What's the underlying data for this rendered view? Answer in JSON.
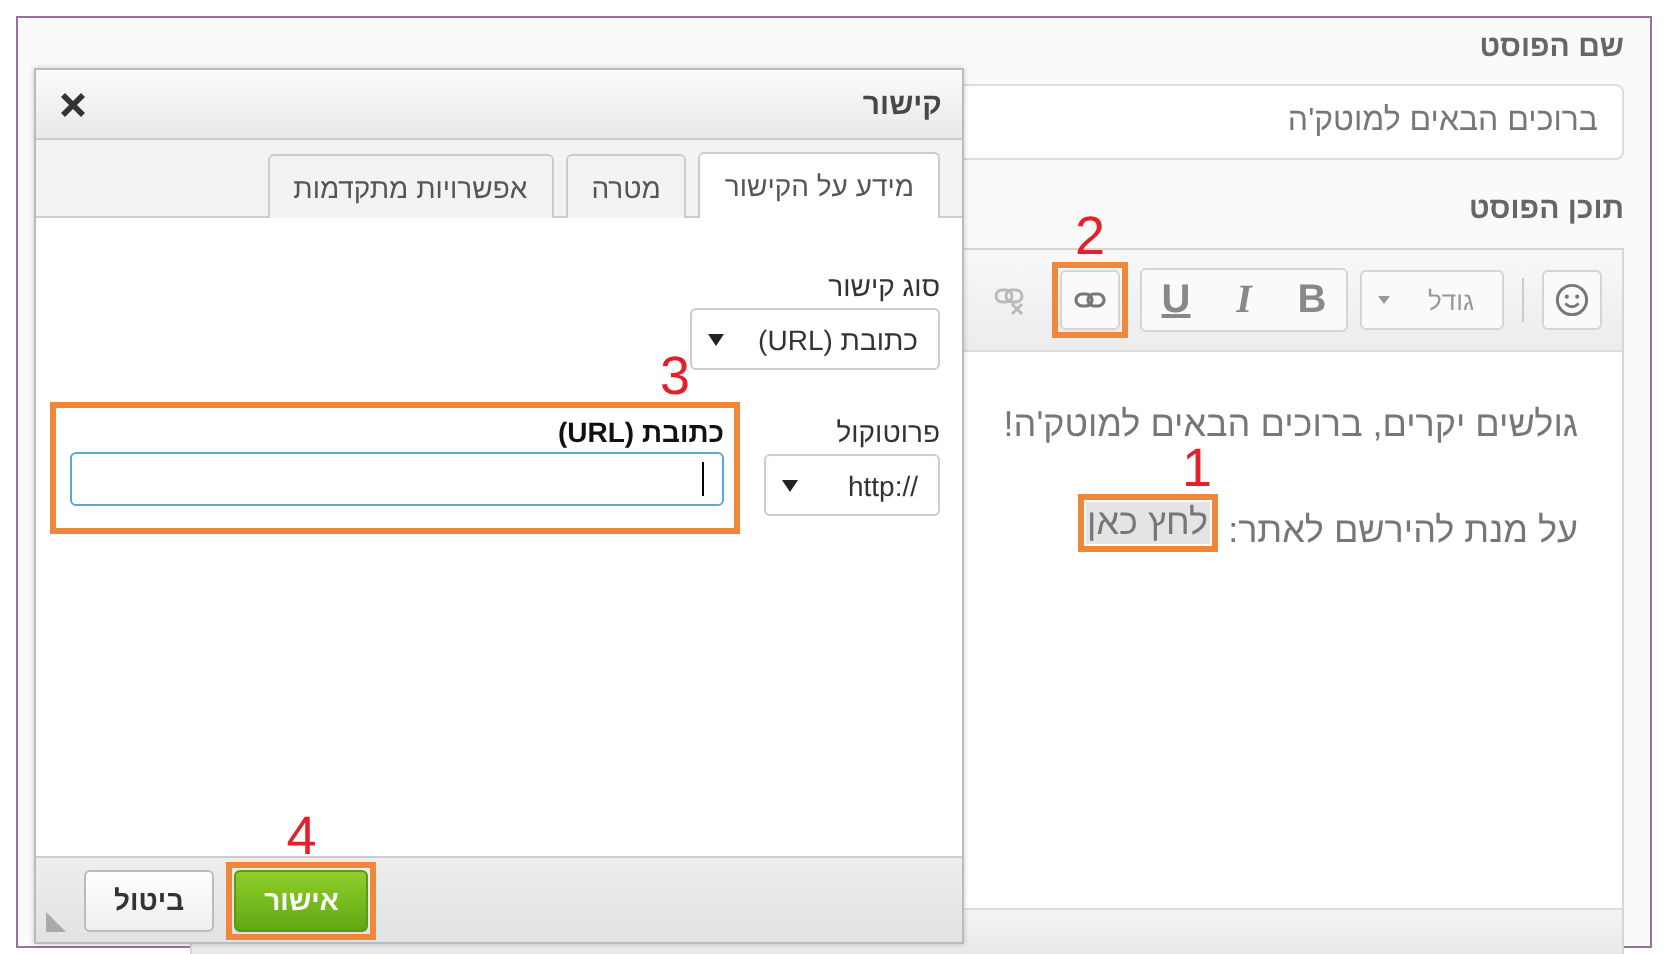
{
  "post_form": {
    "title_label": "שם הפוסט",
    "title_value": "ברוכים הבאים למוטק'ה",
    "content_label": "תוכן הפוסט",
    "toolbar": {
      "font_size": "גודל",
      "format_buttons": [
        {
          "label": "B",
          "kind": "bold"
        },
        {
          "label": "I",
          "kind": "italic"
        },
        {
          "label": "U",
          "kind": "underline"
        }
      ],
      "link_callout": "2",
      "unlink_disabled": true
    },
    "body_lines": [
      {
        "text": "גולשים יקרים, ברוכים הבאים למוטק'ה!"
      },
      {
        "text": "על מנת להירשם לאתר:",
        "link": "לחץ כאן",
        "callout": "1"
      }
    ]
  },
  "dialog": {
    "title": "קישור",
    "tabs": [
      {
        "label": "מידע על הקישור",
        "selected": true
      },
      {
        "label": "מטרה",
        "selected": false
      },
      {
        "label": "אפשרויות מתקדמות",
        "selected": false
      }
    ],
    "link_type": {
      "label": "סוג קישור",
      "value": "כתובת (URL)"
    },
    "protocol": {
      "label": "פרוטוקול",
      "value": "http://"
    },
    "url": {
      "label": "כתובת (URL)",
      "focused": true,
      "callout": "3"
    },
    "buttons": [
      {
        "label": "אישור",
        "kind": "primary",
        "callout": "4"
      },
      {
        "label": "ביטול",
        "kind": "secondary"
      }
    ]
  }
}
